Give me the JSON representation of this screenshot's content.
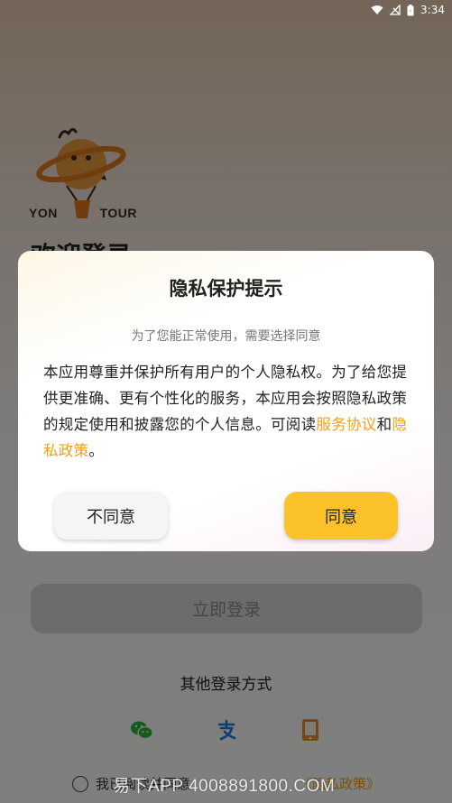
{
  "status_bar": {
    "time": "3:34"
  },
  "brand": {
    "logo_left": "YON",
    "logo_right": "TOUR"
  },
  "login": {
    "welcome": "欢迎登录",
    "login_button": "立即登录",
    "other_methods_title": "其他登录方式",
    "social_icons": [
      "wechat-icon",
      "alipay-icon",
      "phone-icon"
    ],
    "agreement_prefix": "我已阅读并同意",
    "agreement_link": "《隐私政策》"
  },
  "watermark": "易下APP 4008891800.COM",
  "dialog": {
    "title": "隐私保护提示",
    "subtitle": "为了您能正常使用，需要选择同意",
    "body_text": "本应用尊重并保护所有用户的个人隐私权。为了给您提供更准确、更有个性化的服务，本应用会按照隐私政策的规定使用和披露您的个人信息。可阅读",
    "service_link": "服务协议",
    "and_text": "和",
    "privacy_link": "隐私政策",
    "end_text": "。",
    "disagree_label": "不同意",
    "agree_label": "同意"
  },
  "colors": {
    "accent": "#fbc22a",
    "link": "#f0a020",
    "login_disabled": "#d9d9d9"
  }
}
